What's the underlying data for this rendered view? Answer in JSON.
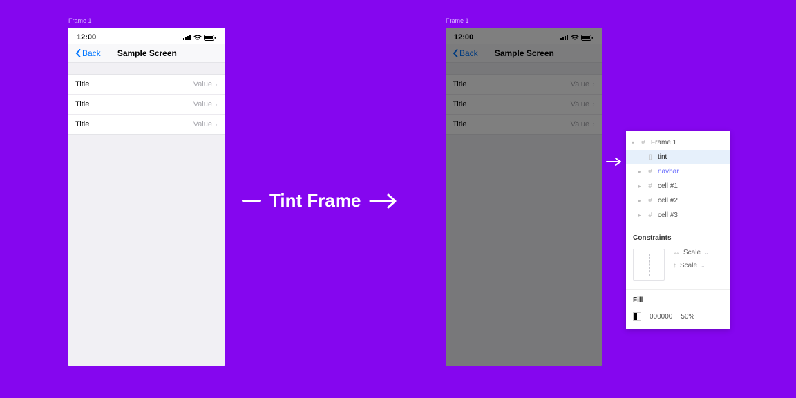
{
  "frame_label": "Frame 1",
  "status": {
    "time": "12:00"
  },
  "nav": {
    "back": "Back",
    "title": "Sample Screen"
  },
  "cells": [
    {
      "title": "Title",
      "value": "Value"
    },
    {
      "title": "Title",
      "value": "Value"
    },
    {
      "title": "Title",
      "value": "Value"
    }
  ],
  "center": {
    "label": "Tint Frame"
  },
  "panel": {
    "layers": {
      "frame": "Frame 1",
      "tint": "tint",
      "navbar": "navbar",
      "cell1": "cell #1",
      "cell2": "cell #2",
      "cell3": "cell #3"
    },
    "constraints": {
      "heading": "Constraints",
      "h_mode": "Scale",
      "v_mode": "Scale"
    },
    "fill": {
      "heading": "Fill",
      "hex": "000000",
      "opacity": "50%"
    }
  }
}
